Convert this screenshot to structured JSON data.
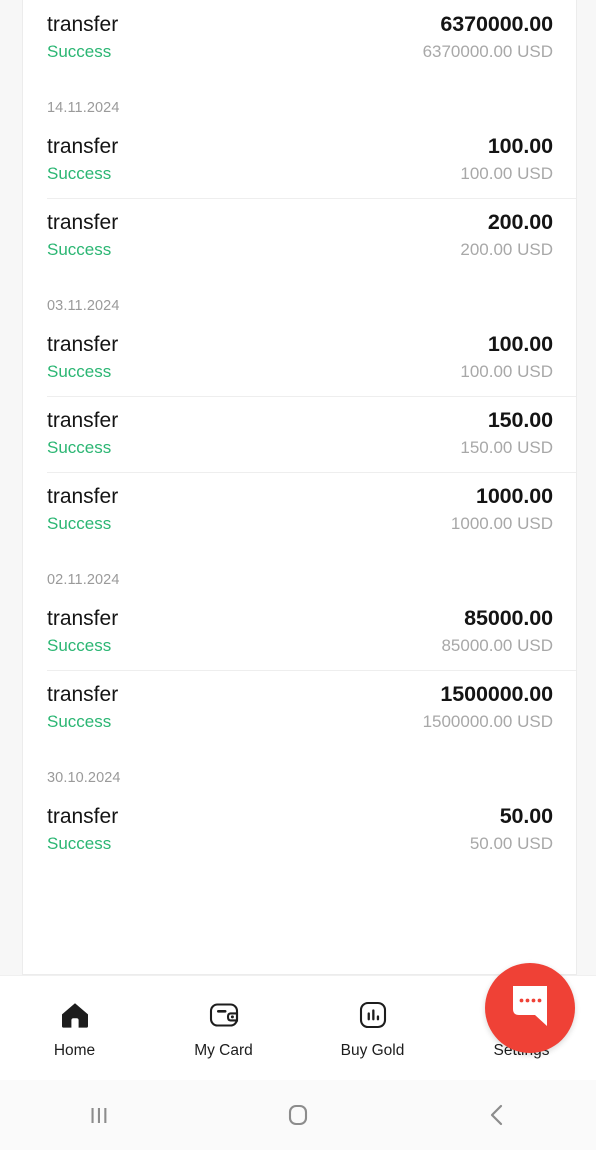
{
  "transactions": {
    "groups": [
      {
        "date": null,
        "rows": [
          {
            "title": "transfer",
            "status": "Success",
            "amount": "6370000.00",
            "currency": "6370000.00 USD",
            "divider": false
          }
        ]
      },
      {
        "date": "14.11.2024",
        "rows": [
          {
            "title": "transfer",
            "status": "Success",
            "amount": "100.00",
            "currency": "100.00 USD",
            "divider": false
          },
          {
            "title": "transfer",
            "status": "Success",
            "amount": "200.00",
            "currency": "200.00 USD",
            "divider": true
          }
        ]
      },
      {
        "date": "03.11.2024",
        "rows": [
          {
            "title": "transfer",
            "status": "Success",
            "amount": "100.00",
            "currency": "100.00 USD",
            "divider": false
          },
          {
            "title": "transfer",
            "status": "Success",
            "amount": "150.00",
            "currency": "150.00 USD",
            "divider": true
          },
          {
            "title": "transfer",
            "status": "Success",
            "amount": "1000.00",
            "currency": "1000.00 USD",
            "divider": true
          }
        ]
      },
      {
        "date": "02.11.2024",
        "rows": [
          {
            "title": "transfer",
            "status": "Success",
            "amount": "85000.00",
            "currency": "85000.00 USD",
            "divider": false
          },
          {
            "title": "transfer",
            "status": "Success",
            "amount": "1500000.00",
            "currency": "1500000.00 USD",
            "divider": true
          }
        ]
      },
      {
        "date": "30.10.2024",
        "rows": [
          {
            "title": "transfer",
            "status": "Success",
            "amount": "50.00",
            "currency": "50.00 USD",
            "divider": false
          }
        ]
      }
    ]
  },
  "tabbar": {
    "items": [
      {
        "label": "Home",
        "icon": "home-icon",
        "active": true
      },
      {
        "label": "My Card",
        "icon": "card-icon",
        "active": false
      },
      {
        "label": "Buy Gold",
        "icon": "bar-chart-icon",
        "active": false
      },
      {
        "label": "Settings",
        "icon": "settings-icon",
        "active": false
      }
    ]
  },
  "chat_fab": {
    "icon": "chat-bubble-icon",
    "color": "#ef4136"
  },
  "system_nav": {
    "buttons": [
      {
        "name": "recent-apps",
        "icon": "recent-apps-icon"
      },
      {
        "name": "home",
        "icon": "home-square-icon"
      },
      {
        "name": "back",
        "icon": "back-chevron-icon"
      }
    ]
  },
  "colors": {
    "success": "#2bb673",
    "amount": "#141414",
    "muted": "#a8a8a8",
    "date": "#9a9a9a",
    "fab": "#ef4136"
  }
}
